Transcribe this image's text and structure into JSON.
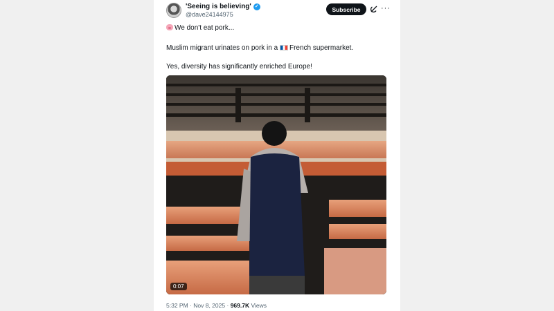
{
  "author": {
    "name": "'Seeing is believing'",
    "handle": "@dave24144975"
  },
  "subscribe_label": "Subscribe",
  "post": {
    "line1": "We don't eat pork...",
    "line2_before": "Muslim migrant urinates on pork in a ",
    "line2_after": "French supermarket.",
    "line3": "Yes, diversity has significantly enriched Europe!"
  },
  "video": {
    "duration": "0:07"
  },
  "meta": {
    "time": "5:32 PM",
    "dot": "·",
    "date": "Nov 8, 2025",
    "views_count": "969.7K",
    "views_label": "Views"
  },
  "colors": {
    "verified": "#1d9bf0",
    "subscribe_bg": "#0f1419",
    "page_bg": "#f0f0f0"
  },
  "icons": [
    "avatar",
    "verified-badge-icon",
    "grok-icon",
    "more-icon",
    "pig-emoji-icon",
    "france-flag-icon"
  ]
}
